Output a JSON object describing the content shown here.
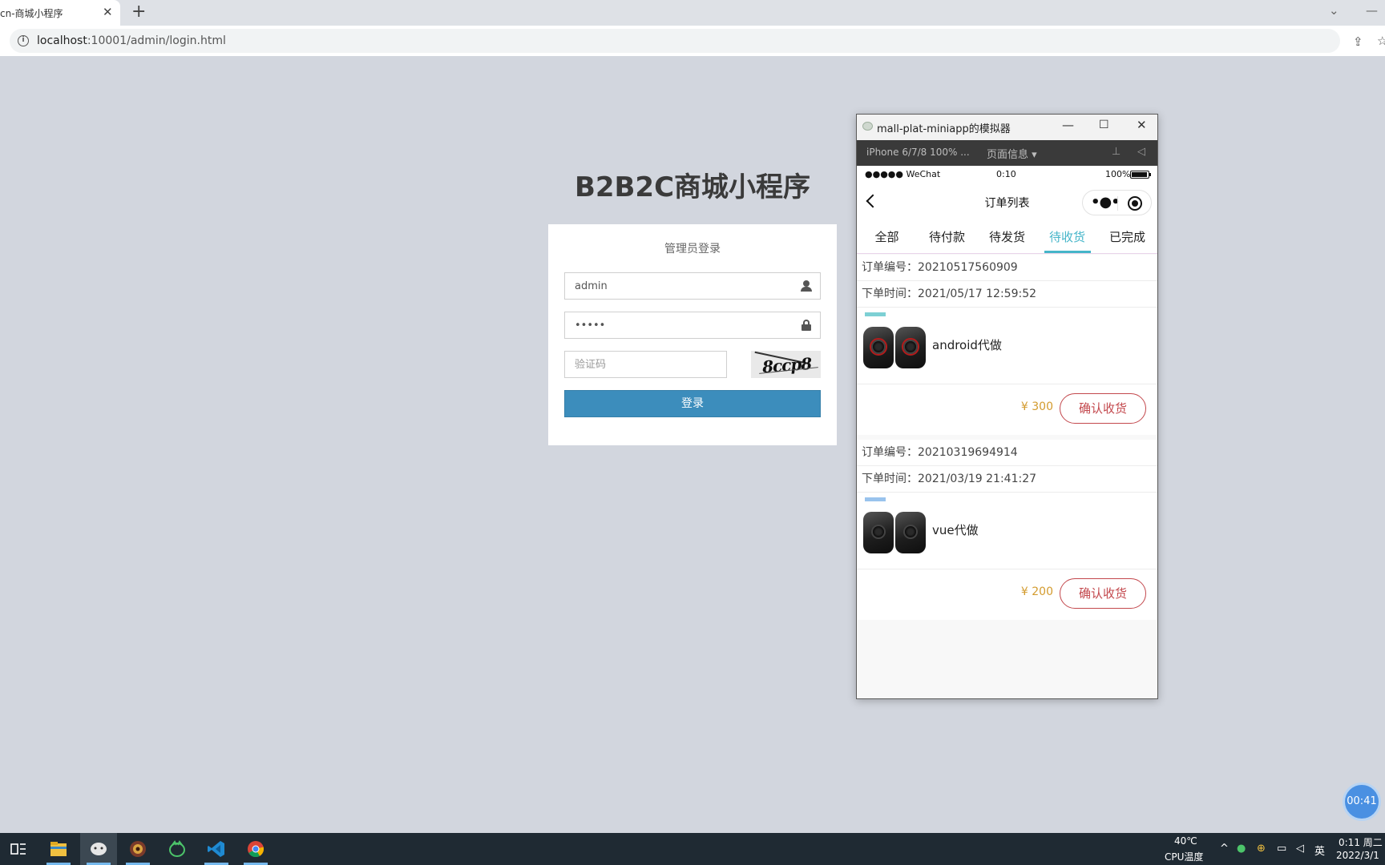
{
  "browser": {
    "tab_title": "cn-商城小程序",
    "tab_close": "✕",
    "new_tab": "+",
    "url_host": "localhost",
    "url_path": ":10001/admin/login.html"
  },
  "login": {
    "page_title": "B2B2C商城小程序",
    "heading": "管理员登录",
    "username_value": "admin",
    "password_value": "admin",
    "captcha_placeholder": "验证码",
    "captcha_image_text": "8ccp8",
    "submit_label": "登录"
  },
  "simulator": {
    "window_title": "mall-plat-miniapp的模拟器",
    "device_label": "iPhone 6/7/8 100% ...",
    "page_info_label": "页面信息 ▾",
    "status": {
      "carrier": "●●●●● WeChat",
      "time": "0:10",
      "battery": "100%"
    },
    "nav_title": "订单列表",
    "tabs": [
      {
        "label": "全部"
      },
      {
        "label": "待付款"
      },
      {
        "label": "待发货"
      },
      {
        "label": "待收货"
      },
      {
        "label": "已完成"
      }
    ],
    "active_tab": "待收货",
    "orders": [
      {
        "order_no": "订单编号：20210517560909",
        "order_time": "下单时间：2021/05/17 12:59:52",
        "product_name": "android代做",
        "price": "¥ 300",
        "action": "确认收货"
      },
      {
        "order_no": "订单编号：20210319694914",
        "order_time": "下单时间：2021/03/19 21:41:27",
        "product_name": "vue代做",
        "price": "¥ 200",
        "action": "确认收货"
      }
    ]
  },
  "timer_bubble": "00:41",
  "taskbar": {
    "temperature": "40℃",
    "temperature_label": "CPU温度",
    "ime": "英",
    "clock_time": "0:11 周二",
    "clock_date": "2022/3/1"
  },
  "colors": {
    "page_background": "#d2d6de",
    "login_button": "#3c8dbc",
    "active_tab": "#45b5c9",
    "price": "#d39b2e",
    "confirm_button": "#c3484d",
    "taskbar": "#1f2a33"
  },
  "icons": [
    "info-icon",
    "share-icon",
    "star-icon",
    "user-icon",
    "lock-icon",
    "back-icon",
    "more-icon",
    "target-icon",
    "windows-icon",
    "folder-icon",
    "wechat-icon",
    "vscode-icon",
    "chrome-icon"
  ]
}
